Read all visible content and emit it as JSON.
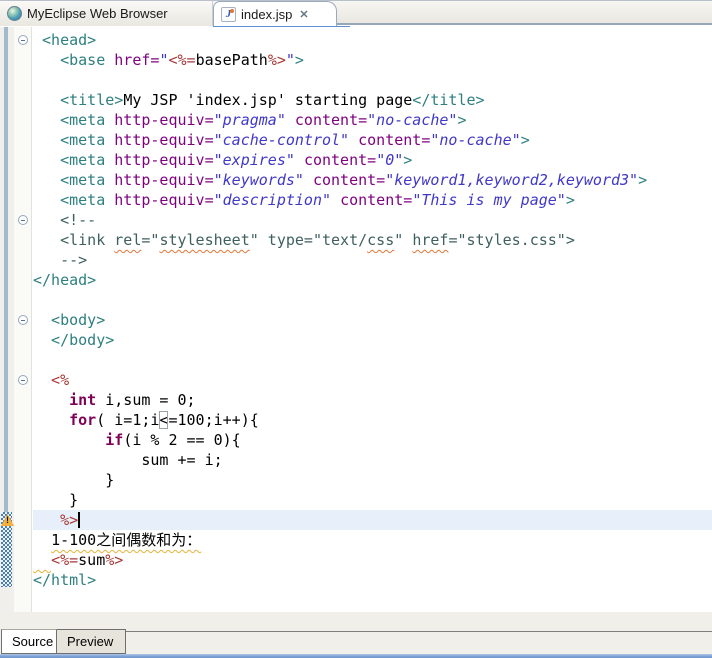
{
  "editor_tabs": [
    {
      "label": "MyEclipse Web Browser",
      "icon": "globe",
      "active": false
    },
    {
      "label": "index.jsp",
      "icon": "jsp-file",
      "active": true,
      "close_glyph": "✕"
    }
  ],
  "bottom_tabs": [
    {
      "label": "Source",
      "active": true
    },
    {
      "label": "Preview",
      "active": false
    }
  ],
  "jsp_icon_letter": "J",
  "colors": {
    "tag": "#2E7F7F",
    "attr": "#7F007F",
    "val": "#4038C8",
    "jsp": "#A83838",
    "kw": "#7F0055",
    "comment": "#3F5F5F",
    "plain": "#000000",
    "wavySpell": "#E07839",
    "wavyWarn": "#E5B43C",
    "currentLine": "#E7F0FA",
    "checker": "#4D7FAE",
    "rangeStrip": "#A3BACD"
  },
  "code": {
    "language": "jsp",
    "lines": [
      {
        "fold": true,
        "seg": [
          [
            "t",
            " <head>"
          ]
        ]
      },
      {
        "seg": [
          [
            "t",
            "   <base "
          ],
          [
            "a",
            "href="
          ],
          [
            "v",
            "\""
          ],
          [
            "j",
            "<%="
          ],
          [
            "p",
            "basePath"
          ],
          [
            "j",
            "%>"
          ],
          [
            "v",
            "\""
          ],
          [
            "t",
            ">"
          ]
        ]
      },
      {
        "seg": []
      },
      {
        "seg": [
          [
            "t",
            "   <title>"
          ],
          [
            "p",
            "My JSP 'index.jsp' starting page"
          ],
          [
            "t",
            "</title>"
          ]
        ]
      },
      {
        "seg": [
          [
            "t",
            "   <meta "
          ],
          [
            "a",
            "http-equiv="
          ],
          [
            "v",
            "\"pragma\""
          ],
          [
            "p",
            " "
          ],
          [
            "a",
            "content="
          ],
          [
            "v",
            "\"no-cache\""
          ],
          [
            "t",
            ">"
          ]
        ]
      },
      {
        "seg": [
          [
            "t",
            "   <meta "
          ],
          [
            "a",
            "http-equiv="
          ],
          [
            "v",
            "\"cache-control\""
          ],
          [
            "p",
            " "
          ],
          [
            "a",
            "content="
          ],
          [
            "v",
            "\"no-cache\""
          ],
          [
            "t",
            ">"
          ]
        ]
      },
      {
        "seg": [
          [
            "t",
            "   <meta "
          ],
          [
            "a",
            "http-equiv="
          ],
          [
            "v",
            "\"expires\""
          ],
          [
            "p",
            " "
          ],
          [
            "a",
            "content="
          ],
          [
            "v",
            "\"0\""
          ],
          [
            "t",
            ">"
          ]
        ]
      },
      {
        "seg": [
          [
            "t",
            "   <meta "
          ],
          [
            "a",
            "http-equiv="
          ],
          [
            "v",
            "\"keywords\""
          ],
          [
            "p",
            " "
          ],
          [
            "a",
            "content="
          ],
          [
            "v",
            "\"keyword1,keyword2,keyword3\""
          ],
          [
            "t",
            ">"
          ]
        ]
      },
      {
        "seg": [
          [
            "t",
            "   <meta "
          ],
          [
            "a",
            "http-equiv="
          ],
          [
            "v",
            "\"description\""
          ],
          [
            "p",
            " "
          ],
          [
            "a",
            "content="
          ],
          [
            "v",
            "\"This is my page\""
          ],
          [
            "t",
            ">"
          ]
        ]
      },
      {
        "fold": true,
        "seg": [
          [
            "c",
            "   <!--"
          ]
        ]
      },
      {
        "seg": [
          [
            "c",
            "   <link "
          ],
          [
            "x",
            "rel"
          ],
          [
            "c",
            "=\""
          ],
          [
            "x",
            "stylesheet"
          ],
          [
            "c",
            "\" type=\"text/"
          ],
          [
            "x",
            "css"
          ],
          [
            "c",
            "\" "
          ],
          [
            "x",
            "href"
          ],
          [
            "c",
            "=\"styles.css\">"
          ]
        ]
      },
      {
        "seg": [
          [
            "c",
            "   -->"
          ]
        ]
      },
      {
        "seg": [
          [
            "t",
            "</head>"
          ]
        ]
      },
      {
        "seg": []
      },
      {
        "fold": true,
        "seg": [
          [
            "t",
            "  <body>"
          ]
        ]
      },
      {
        "seg": [
          [
            "t",
            "  </body>"
          ]
        ]
      },
      {
        "seg": []
      },
      {
        "fold": true,
        "seg": [
          [
            "j",
            "  <%"
          ]
        ]
      },
      {
        "seg": [
          [
            "p",
            "    "
          ],
          [
            "k",
            "int"
          ],
          [
            "p",
            " i,sum = 0;"
          ]
        ]
      },
      {
        "seg": [
          [
            "p",
            "    "
          ],
          [
            "k",
            "for"
          ],
          [
            "p",
            "( i=1;i"
          ],
          [
            "b",
            "<"
          ],
          [
            "p",
            "=100;i++){"
          ]
        ]
      },
      {
        "seg": [
          [
            "p",
            "        "
          ],
          [
            "k",
            "if"
          ],
          [
            "p",
            "(i % 2 == 0){"
          ]
        ]
      },
      {
        "seg": [
          [
            "p",
            "            sum += i;"
          ]
        ]
      },
      {
        "seg": [
          [
            "p",
            "        }"
          ]
        ]
      },
      {
        "seg": [
          [
            "p",
            "    }"
          ]
        ]
      },
      {
        "current": true,
        "cursor": true,
        "seg": [
          [
            "j",
            "   %>"
          ]
        ]
      },
      {
        "seg": [
          [
            "p",
            "  "
          ],
          [
            "w",
            "1-100之间偶数和为："
          ]
        ]
      },
      {
        "seg": [
          [
            "w",
            "  "
          ],
          [
            "j",
            "<%="
          ],
          [
            "p",
            "sum"
          ],
          [
            "j",
            "%>"
          ]
        ]
      },
      {
        "seg": [
          [
            "t",
            "</html>"
          ]
        ]
      }
    ]
  },
  "annotations": {
    "warning_line": 25,
    "warning_glyph": "!"
  }
}
